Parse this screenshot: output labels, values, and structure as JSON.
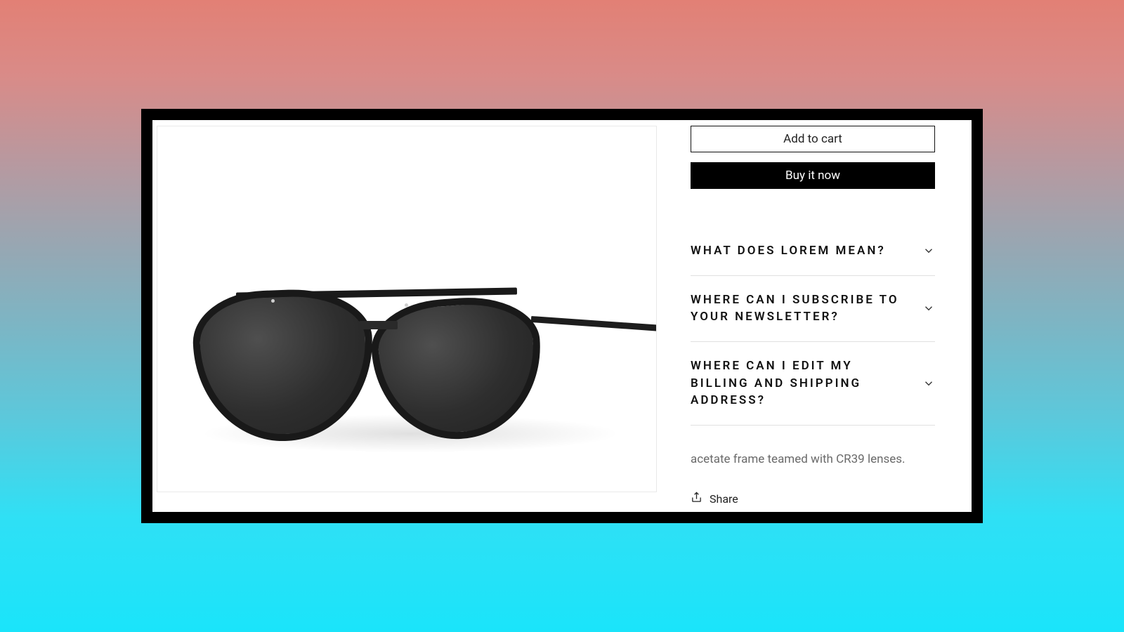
{
  "buttons": {
    "add_to_cart": "Add to cart",
    "buy_now": "Buy it now"
  },
  "accordion": [
    {
      "title": "WHAT DOES LOREM MEAN?"
    },
    {
      "title": "WHERE CAN I SUBSCRIBE TO YOUR NEWSLETTER?"
    },
    {
      "title": "WHERE CAN I EDIT MY BILLING AND SHIPPING ADDRESS?"
    }
  ],
  "description": "acetate frame teamed with CR39 lenses.",
  "share_label": "Share",
  "product_image": {
    "alt": "Black aviator sunglasses"
  }
}
